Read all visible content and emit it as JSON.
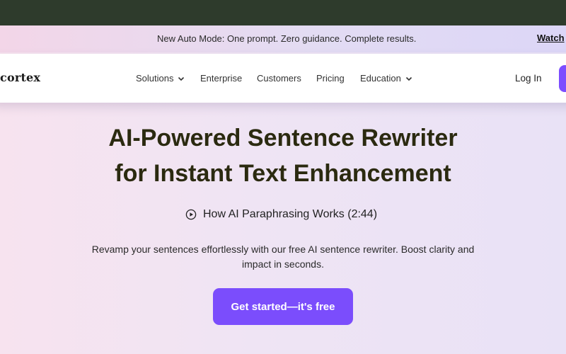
{
  "announcement": {
    "message": "New Auto Mode: One prompt. Zero guidance. Complete results.",
    "link_label": "Watch"
  },
  "nav": {
    "logo": "cortex",
    "items": [
      {
        "label": "Solutions",
        "has_dropdown": true
      },
      {
        "label": "Enterprise",
        "has_dropdown": false
      },
      {
        "label": "Customers",
        "has_dropdown": false
      },
      {
        "label": "Pricing",
        "has_dropdown": false
      },
      {
        "label": "Education",
        "has_dropdown": true
      }
    ],
    "login_label": "Log In"
  },
  "hero": {
    "title_line1": "AI-Powered Sentence Rewriter",
    "title_line2": "for Instant Text Enhancement",
    "video_label": "How AI Paraphrasing Works (2:44)",
    "description_line1": "Revamp your sentences effortlessly with our free AI sentence rewriter. Boost clarity and",
    "description_line2": "impact in seconds.",
    "cta_label": "Get started—it's free"
  },
  "colors": {
    "accent": "#7b4dfc",
    "top_strip": "#2e3b2c",
    "heading": "#2b2a10"
  },
  "icons": {
    "play": "play-circle-icon",
    "dropdown": "chevron-down-icon"
  }
}
